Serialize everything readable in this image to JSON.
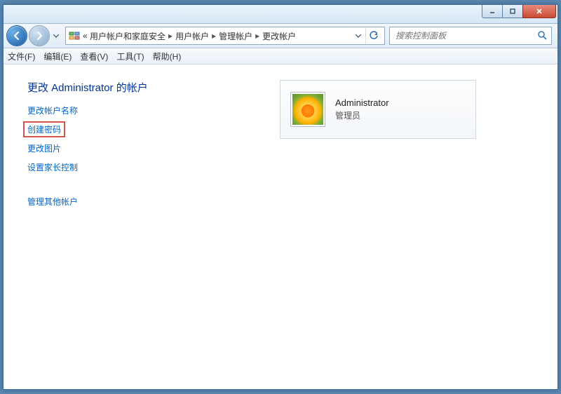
{
  "window_controls": {
    "minimize": "minimize",
    "maximize": "maximize",
    "close": "close"
  },
  "breadcrumb": {
    "overflow": "«",
    "items": [
      "用户帐户和家庭安全",
      "用户帐户",
      "管理帐户",
      "更改帐户"
    ]
  },
  "search": {
    "placeholder": "搜索控制面板"
  },
  "menubar": {
    "file": "文件(F)",
    "edit": "编辑(E)",
    "view": "查看(V)",
    "tools": "工具(T)",
    "help": "帮助(H)"
  },
  "page": {
    "heading": "更改 Administrator 的帐户",
    "links": {
      "change_name": "更改帐户名称",
      "create_password": "创建密码",
      "change_picture": "更改图片",
      "parental_controls": "设置家长控制",
      "manage_other": "管理其他帐户"
    }
  },
  "account": {
    "name": "Administrator",
    "role": "管理员"
  }
}
